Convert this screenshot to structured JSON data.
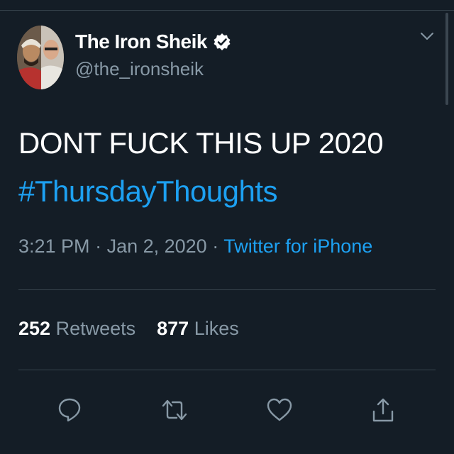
{
  "author": {
    "name": "The Iron Sheik",
    "handle": "@the_ironsheik",
    "verified": true
  },
  "tweet": {
    "text": "DONT FUCK THIS UP 2020",
    "hashtag": "#ThursdayThoughts",
    "time": "3:21 PM",
    "separator": " · ",
    "date": "Jan 2, 2020",
    "separator2": " · ",
    "source": "Twitter for iPhone"
  },
  "stats": {
    "retweets_count": "252",
    "retweets_label": " Retweets",
    "likes_count": "877",
    "likes_label": " Likes"
  },
  "actions": {
    "icons": [
      "reply-icon",
      "retweet-icon",
      "like-icon",
      "share-icon"
    ]
  },
  "colors": {
    "background": "#141d26",
    "accent": "#1da1f2",
    "secondary_text": "#8899a6",
    "divider": "#38444d"
  }
}
